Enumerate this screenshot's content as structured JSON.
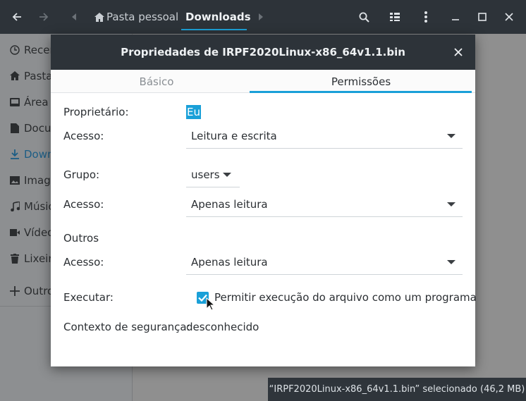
{
  "colors": {
    "accent": "#1aa0d8",
    "headerbar": "#2d3339",
    "dim_overlay": "#8e8e8e"
  },
  "headerbar": {
    "back_icon": "arrow-left-icon",
    "forward_icon": "arrow-right-icon",
    "crumb_prev_icon": "chevron-left-icon",
    "crumb_next_icon": "chevron-right-icon",
    "home_icon": "home-icon",
    "crumbs": [
      "Pasta pessoal",
      "Downloads"
    ],
    "search_icon": "search-icon",
    "view_icon": "list-view-icon",
    "menu_icon": "kebab-menu-icon",
    "minimize_icon": "minimize-icon",
    "maximize_icon": "maximize-icon",
    "close_icon": "close-icon"
  },
  "sidebar": {
    "items": [
      {
        "label": "Recen",
        "icon": "clock-icon"
      },
      {
        "label": "Pasta",
        "icon": "home-icon"
      },
      {
        "label": "Área c",
        "icon": "desktop-icon"
      },
      {
        "label": "Docur",
        "icon": "document-icon"
      },
      {
        "label": "Down",
        "icon": "download-icon"
      },
      {
        "label": "Image",
        "icon": "image-icon"
      },
      {
        "label": "Músic",
        "icon": "music-icon"
      },
      {
        "label": "Vídeo",
        "icon": "video-icon"
      },
      {
        "label": "Lixeir",
        "icon": "trash-icon"
      },
      {
        "label": "Outro",
        "icon": "plus-icon"
      }
    ]
  },
  "statusbar": {
    "text": "“IRPF2020Linux-x86_64v1.1.bin” selecionado  (46,2 MB)"
  },
  "dialog": {
    "title": "Propriedades de IRPF2020Linux-x86_64v1.1.bin",
    "tabs": [
      "Básico",
      "Permissões"
    ],
    "active_tab": "Permissões",
    "owner_label": "Proprietário:",
    "owner_value": "Eu",
    "owner_access_label": "Acesso:",
    "owner_access_value": "Leitura e escrita",
    "group_label": "Grupo:",
    "group_value": "users",
    "group_access_label": "Acesso:",
    "group_access_value": "Apenas leitura",
    "others_label": "Outros",
    "others_access_label": "Acesso:",
    "others_access_value": "Apenas leitura",
    "execute_label": "Executar:",
    "execute_checked": true,
    "execute_text": "Permitir execução do arquivo como um programa",
    "security_label": "Contexto de segurança:",
    "security_value": "desconhecido"
  }
}
